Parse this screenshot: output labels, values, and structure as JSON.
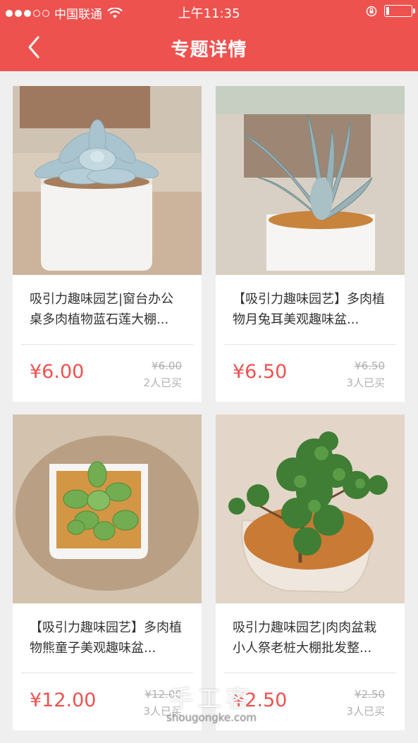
{
  "status_bar": {
    "carrier": "中国联通",
    "time": "上午11:35"
  },
  "nav": {
    "title": "专题详情"
  },
  "products": [
    {
      "name": "吸引力趣味园艺|窗台办公桌多肉植物蓝石莲大棚...",
      "price": "¥6.00",
      "original_price": "¥6.00",
      "sold": "2人已买"
    },
    {
      "name": "【吸引力趣味园艺】多肉植物月兔耳美观趣味盆...",
      "price": "¥6.50",
      "original_price": "¥6.50",
      "sold": "3人已买"
    },
    {
      "name": "【吸引力趣味园艺】多肉植物熊童子美观趣味盆...",
      "price": "¥12.00",
      "original_price": "¥12.00",
      "sold": "3人已买"
    },
    {
      "name": "吸引力趣味园艺|肉肉盆栽小人祭老桩大棚批发整...",
      "price": "¥2.50",
      "original_price": "¥2.50",
      "sold": "3人已买"
    }
  ],
  "watermark": {
    "logo_text": "手工客",
    "domain": "shougongke.com"
  },
  "colors": {
    "accent": "#ee524f",
    "background": "#efefef"
  }
}
